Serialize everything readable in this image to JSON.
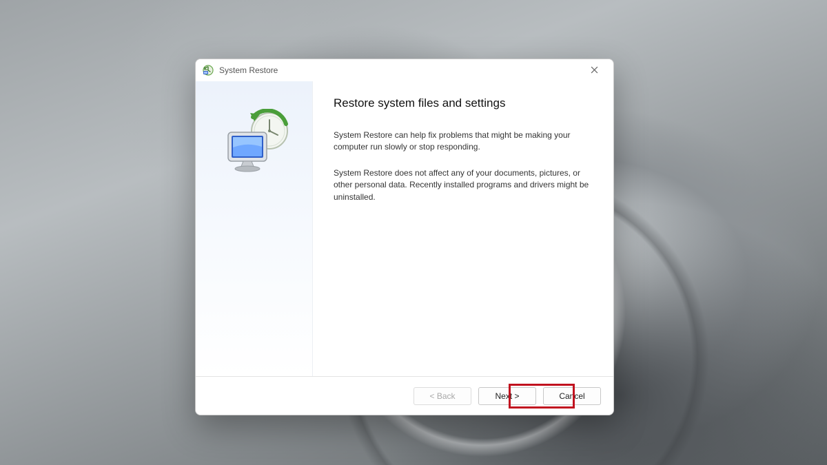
{
  "window": {
    "title": "System Restore"
  },
  "content": {
    "heading": "Restore system files and settings",
    "paragraph1": "System Restore can help fix problems that might be making your computer run slowly or stop responding.",
    "paragraph2": "System Restore does not affect any of your documents, pictures, or other personal data. Recently installed programs and drivers might be uninstalled."
  },
  "buttons": {
    "back": "< Back",
    "next": "Next >",
    "cancel": "Cancel"
  }
}
